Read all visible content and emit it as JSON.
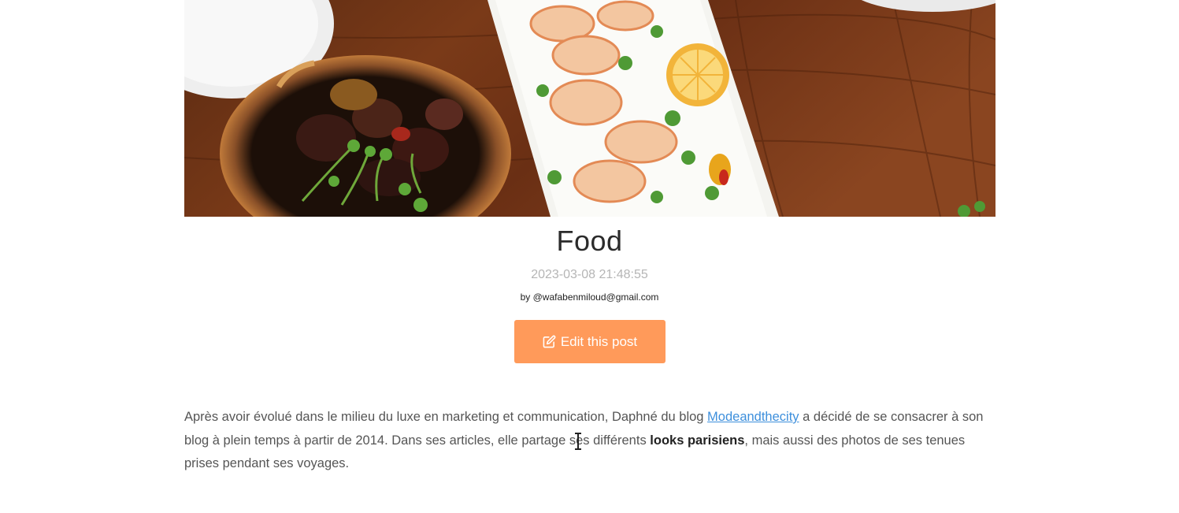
{
  "post": {
    "title": "Food",
    "date": "2023-03-08 21:48:55",
    "author": "by @wafabenmiloud@gmail.com",
    "edit_button_label": "Edit this post",
    "body": {
      "part1": "Après avoir évolué dans le milieu du luxe en marketing et communication, Daphné du blog ",
      "link_text": "Modeandthecity",
      "part2": " a décidé de se consacrer à son blog à plein temps à partir de 2014. Dans ses articles, elle partage ses différents ",
      "bold_text": "looks parisiens",
      "part3": ", mais aussi des photos de ses tenues prises pendant ses voyages."
    }
  },
  "colors": {
    "accent": "#ff9a5a",
    "link": "#3d8fdc",
    "date": "#b5b5b5"
  },
  "icons": {
    "edit": "edit-icon"
  }
}
